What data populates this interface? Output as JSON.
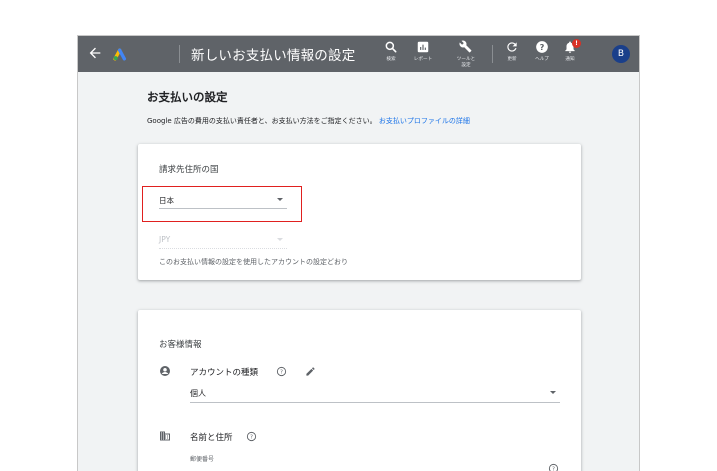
{
  "header": {
    "title": "新しいお支払い情報の設定",
    "tools": {
      "search": "検索",
      "report": "レポート",
      "tools_line1": "ツールと",
      "tools_line2": "設定",
      "refresh": "更新",
      "help": "ヘルプ",
      "notifications": "通知"
    },
    "notification_badge": "!",
    "avatar_initial": "B"
  },
  "page": {
    "title": "お支払いの設定",
    "description": "Google 広告の費用の支払い責任者と、お支払い方法をご指定ください。",
    "profile_link": "お支払いプロファイルの詳細"
  },
  "billing_country_card": {
    "label": "請求先住所の国",
    "country_value": "日本",
    "currency_value": "JPY",
    "hint": "このお支払い情報の設定を使用したアカウントの設定どおり"
  },
  "customer_card": {
    "label": "お客様情報",
    "account_type_label": "アカウントの種類",
    "account_type_value": "個人",
    "name_address_label": "名前と住所",
    "postal_code_label": "郵便番号"
  },
  "colors": {
    "topbar": "#5f6368",
    "accent": "#1a73e8",
    "highlight": "#e0201f",
    "badge": "#d93025"
  }
}
